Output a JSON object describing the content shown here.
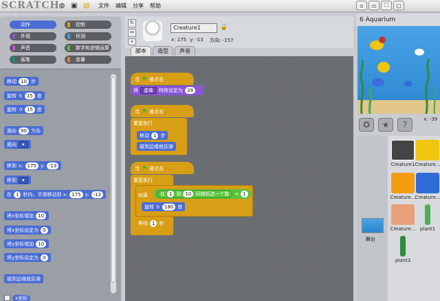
{
  "topbar": {
    "logo": "SCRATCH",
    "menus": [
      "文件",
      "编辑",
      "分享",
      "帮助"
    ]
  },
  "categories": [
    {
      "label": "动作",
      "color": "#4a6cd4",
      "active": true
    },
    {
      "label": "控制",
      "color": "#d89e16"
    },
    {
      "label": "外观",
      "color": "#8a55d7"
    },
    {
      "label": "侦测",
      "color": "#2ca5e2"
    },
    {
      "label": "声音",
      "color": "#c94fc9"
    },
    {
      "label": "数字和逻辑运算",
      "color": "#5ac13a"
    },
    {
      "label": "画笔",
      "color": "#0e9a6c"
    },
    {
      "label": "变量",
      "color": "#ee7d16"
    }
  ],
  "palette": {
    "move": "移动",
    "move_n": "10",
    "move_unit": "步",
    "turn_r": "旋转",
    "turn_r_n": "15",
    "deg": "度",
    "turn_l": "旋转",
    "turn_l_n": "15",
    "face": "面向",
    "face_n": "90",
    "face_unit": "方向",
    "face_to": "面向",
    "goto": "移到",
    "goto_x": "175",
    "goto_y": "-13",
    "y_lbl": "y:",
    "x_lbl": "x:",
    "goto2": "移到",
    "glide": "在",
    "glide_n": "1",
    "glide_mid": "秒内，平滑移动到 x:",
    "glide_x": "175",
    "glide_y": "-13",
    "chx": "将x坐标增加",
    "chx_n": "10",
    "setx": "将x坐标设定为",
    "setx_n": "0",
    "chy": "将y坐标增加",
    "chy_n": "10",
    "sety": "将y坐标设定为",
    "sety_n": "0",
    "bounce": "碰到边缘就反弹",
    "xpos": "x坐标"
  },
  "sprite": {
    "name": "Creature1",
    "x": "x: 175",
    "y": "y: -13",
    "dir": "方向: -157"
  },
  "tabs": [
    "脚本",
    "造型",
    "声音"
  ],
  "scripts": {
    "when": "当",
    "clicked": "被点击",
    "set": "将",
    "effect": "虚像",
    "set_mid": "特效设定为",
    "set_n": "39",
    "forever": "重复执行",
    "move": "移动",
    "move_n": "1",
    "step": "步",
    "bounce": "碰到边缘就反弹",
    "if": "如果",
    "rand_pre": "在",
    "rand_a": "1",
    "rand_to": "到",
    "rand_b": "10",
    "rand_post": "间随机选一个数",
    "eq": "=",
    "eq_n": "1",
    "turn": "旋转",
    "turn_n": "180",
    "deg": "度",
    "wait": "等待",
    "wait_n": "1",
    "sec": "秒"
  },
  "stage": {
    "title": "6 Aquarium",
    "coord": "x: -39"
  },
  "sprites": [
    {
      "name": "Creature1",
      "color": "#f4f4f4"
    },
    {
      "name": "Creature...",
      "color": "#f1c40f"
    },
    {
      "name": "Creature...",
      "color": "#f39c12"
    },
    {
      "name": "Creature...",
      "color": "#2f6bd8"
    },
    {
      "name": "Creature...",
      "color": "#e8a07a"
    },
    {
      "name": "plant1",
      "color": "#4caf50"
    },
    {
      "name": "plant3",
      "color": "#2e8b3d"
    }
  ],
  "stage_thumb": {
    "label": "舞台"
  }
}
